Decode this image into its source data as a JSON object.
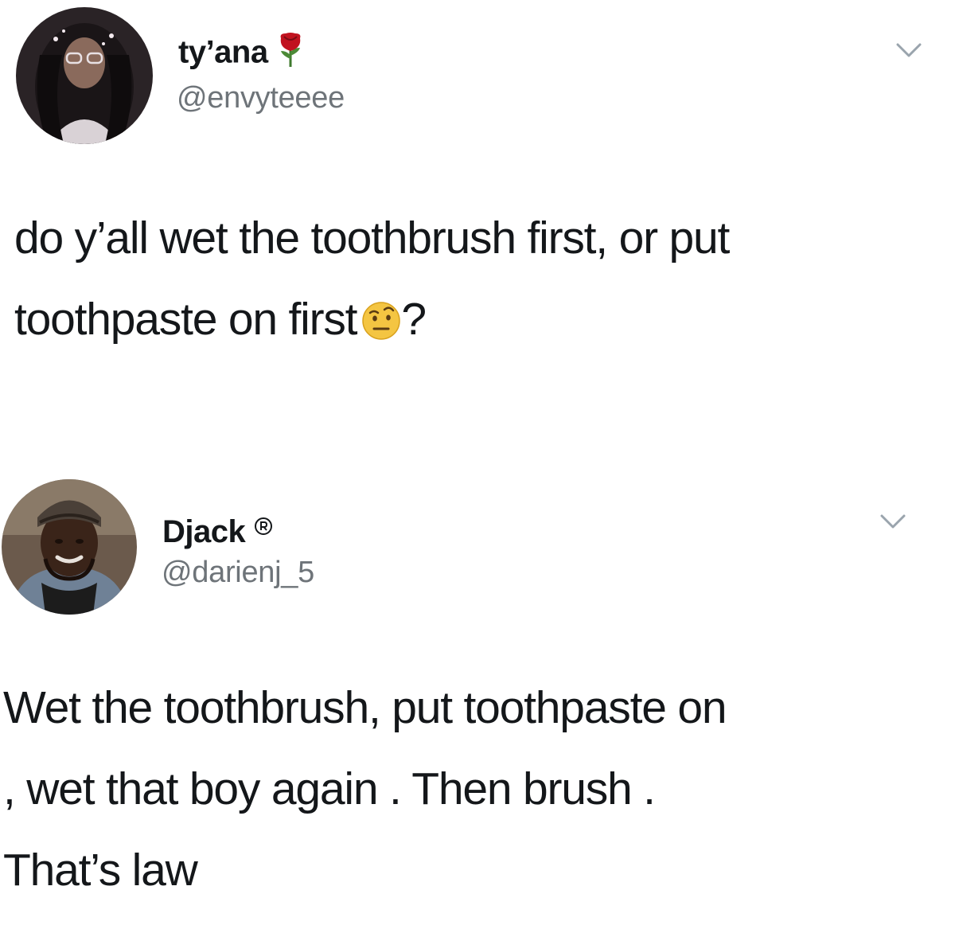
{
  "tweets": [
    {
      "display_name": "ty’ana",
      "name_emoji": "rose-icon",
      "handle": "@envyteeee",
      "text_before_emoji": "do y’all wet the toothbrush first, or put toothpaste on first",
      "text_emoji": "face-with-raised-eyebrow-icon",
      "text_after_emoji": "?"
    },
    {
      "display_name": "Djack",
      "name_emoji": "registered-icon",
      "handle": "@darienj_5",
      "text_lines": [
        "Wet the toothbrush, put toothpaste on",
        ", wet that boy again . Then brush .",
        "That’s law"
      ]
    }
  ],
  "colors": {
    "text": "#14171a",
    "secondary_text": "#6e7479",
    "chevron": "#9aa4ad",
    "background": "#ffffff"
  }
}
